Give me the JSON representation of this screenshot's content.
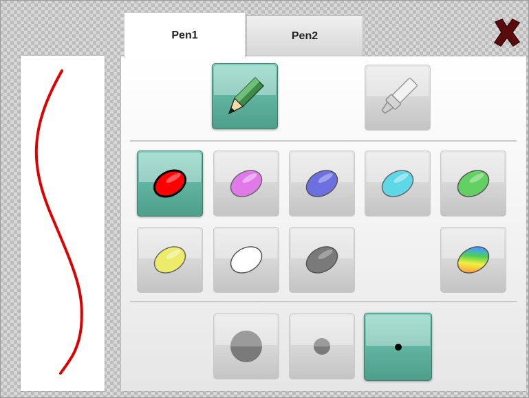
{
  "tabs": [
    {
      "label": "Pen1",
      "selected": true
    },
    {
      "label": "Pen2",
      "selected": false
    }
  ],
  "tools": [
    {
      "name": "pencil",
      "icon": "pencil-icon",
      "selected": true
    },
    {
      "name": "marker",
      "icon": "marker-icon",
      "selected": false
    }
  ],
  "colors": [
    {
      "name": "red",
      "hex": "#ff0000",
      "selected": true
    },
    {
      "name": "pink",
      "hex": "#e07ae8",
      "selected": false
    },
    {
      "name": "blue",
      "hex": "#6b6fe0",
      "selected": false
    },
    {
      "name": "cyan",
      "hex": "#5ed8e6",
      "selected": false
    },
    {
      "name": "green",
      "hex": "#63d063",
      "selected": false
    },
    {
      "name": "yellow",
      "hex": "#ecec6a",
      "selected": false
    },
    {
      "name": "white",
      "hex": "#ffffff",
      "selected": false
    },
    {
      "name": "gray",
      "hex": "#7a7a7a",
      "selected": false
    },
    {
      "name": "rainbow",
      "hex": "rainbow",
      "selected": false
    }
  ],
  "sizes": [
    {
      "name": "large",
      "selected": false
    },
    {
      "name": "medium",
      "selected": false
    },
    {
      "name": "small",
      "selected": true
    }
  ],
  "preview_stroke_color": "#ff0000",
  "close_icon": "close-icon",
  "accent_color": "#5fb29e"
}
